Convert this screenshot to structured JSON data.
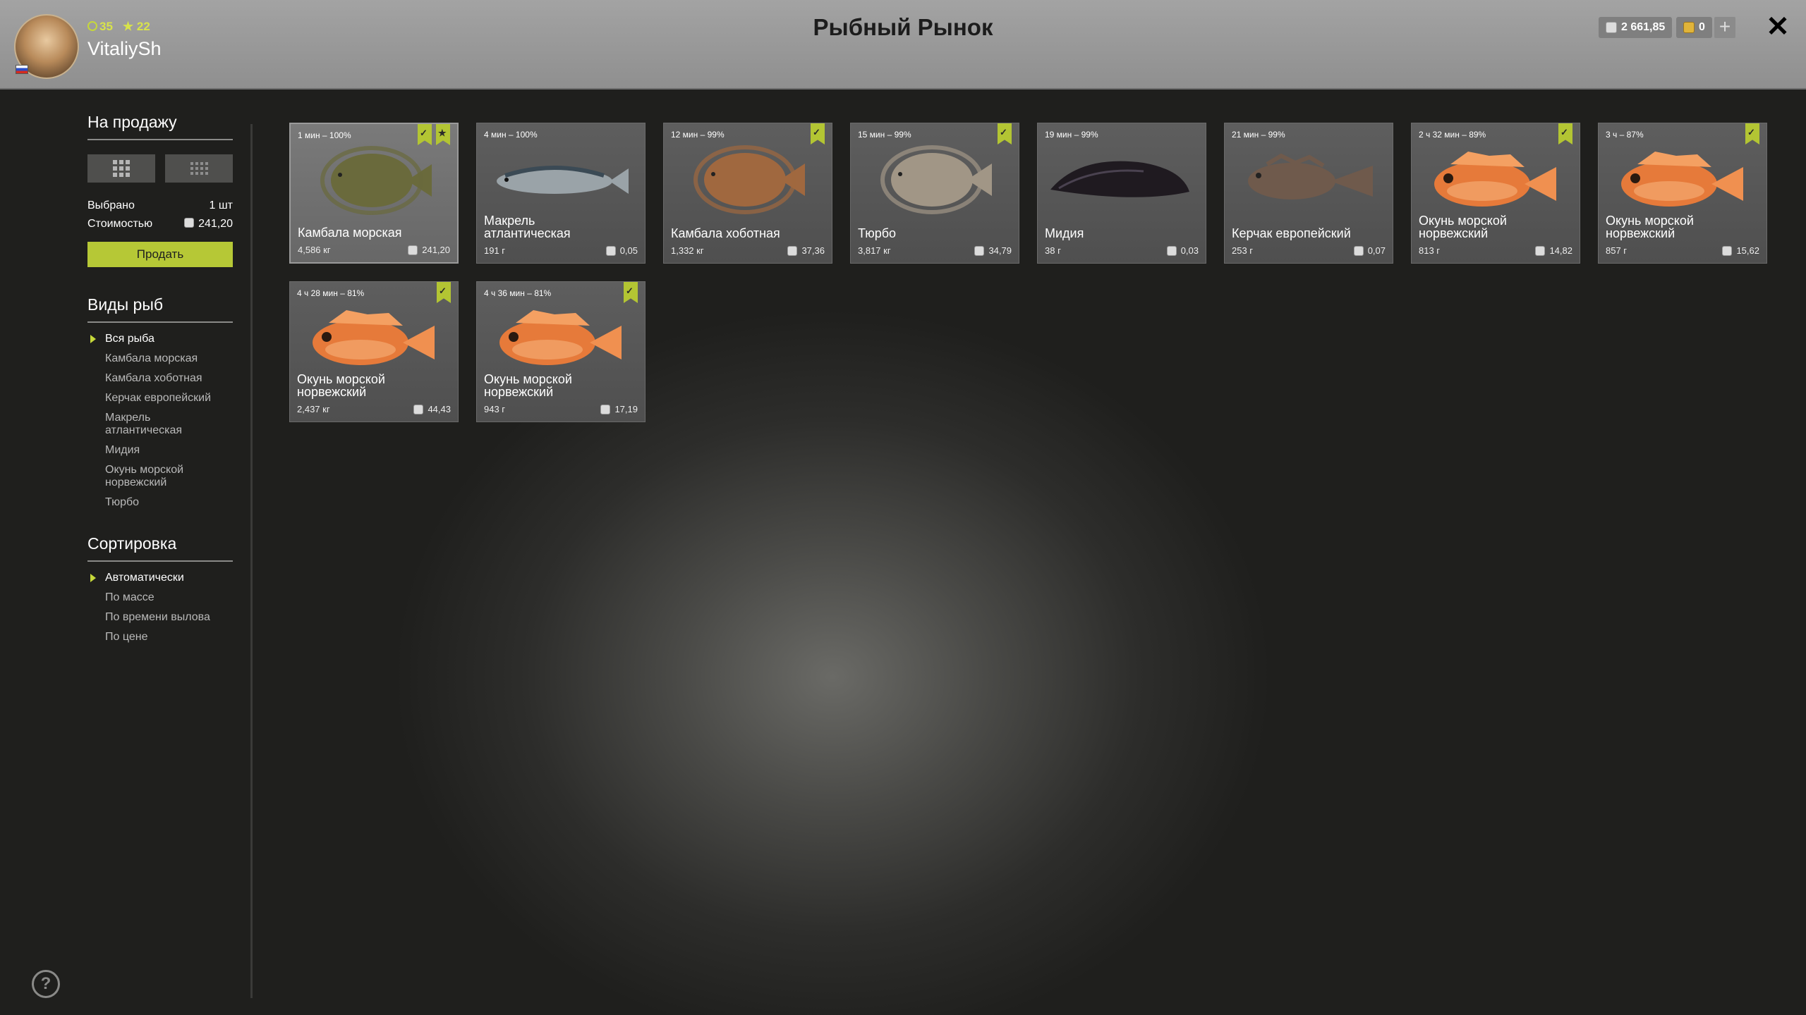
{
  "header": {
    "title": "Рыбный Рынок",
    "level": "35",
    "rating": "22",
    "username": "VitaliySh",
    "silver": "2 661,85",
    "gold": "0"
  },
  "sidebar": {
    "for_sale_title": "На продажу",
    "selected_label": "Выбрано",
    "selected_value": "1 шт",
    "cost_label": "Стоимостью",
    "cost_value": "241,20",
    "sell_label": "Продать",
    "species_title": "Виды рыб",
    "species": [
      "Вся рыба",
      "Камбала морская",
      "Камбала хоботная",
      "Керчак европейский",
      "Макрель атлантическая",
      "Мидия",
      "Окунь морской норвежский",
      "Тюрбо"
    ],
    "sort_title": "Сортировка",
    "sort": [
      "Автоматически",
      "По массе",
      "По времени вылова",
      "По цене"
    ]
  },
  "cards": [
    {
      "time": "1 мин – 100%",
      "name": "Камбала морская",
      "weight": "4,586 кг",
      "price": "241,20",
      "fish": "flounder-green",
      "color": "#6a6a3c",
      "checked": true,
      "starred": true,
      "selected": true
    },
    {
      "time": "4 мин – 100%",
      "name": "Макрель атлантическая",
      "weight": "191 г",
      "price": "0,05",
      "fish": "mackerel",
      "color": "#9aa3a8",
      "checked": false,
      "starred": false,
      "selected": false
    },
    {
      "time": "12 мин – 99%",
      "name": "Камбала хоботная",
      "weight": "1,332 кг",
      "price": "37,36",
      "fish": "flounder-brown",
      "color": "#a0683f",
      "checked": true,
      "starred": false,
      "selected": false
    },
    {
      "time": "15 мин – 99%",
      "name": "Тюрбо",
      "weight": "3,817 кг",
      "price": "34,79",
      "fish": "turbot",
      "color": "#a19686",
      "checked": true,
      "starred": false,
      "selected": false
    },
    {
      "time": "19 мин – 99%",
      "name": "Мидия",
      "weight": "38 г",
      "price": "0,03",
      "fish": "mussel",
      "color": "#1f1a20",
      "checked": false,
      "starred": false,
      "selected": false
    },
    {
      "time": "21 мин – 99%",
      "name": "Керчак европейский",
      "weight": "253 г",
      "price": "0,07",
      "fish": "sculpin",
      "color": "#6f5a4c",
      "checked": false,
      "starred": false,
      "selected": false
    },
    {
      "time": "2 ч 32 мин – 89%",
      "name": "Окунь морской норвежский",
      "weight": "813 г",
      "price": "14,82",
      "fish": "redfish",
      "color": "#e67a3a",
      "checked": true,
      "starred": false,
      "selected": false
    },
    {
      "time": "3 ч – 87%",
      "name": "Окунь морской норвежский",
      "weight": "857 г",
      "price": "15,62",
      "fish": "redfish",
      "color": "#e67a3a",
      "checked": true,
      "starred": false,
      "selected": false
    },
    {
      "time": "4 ч 28 мин – 81%",
      "name": "Окунь морской норвежский",
      "weight": "2,437 кг",
      "price": "44,43",
      "fish": "redfish",
      "color": "#e67a3a",
      "checked": true,
      "starred": false,
      "selected": false
    },
    {
      "time": "4 ч 36 мин – 81%",
      "name": "Окунь морской норвежский",
      "weight": "943 г",
      "price": "17,19",
      "fish": "redfish",
      "color": "#e67a3a",
      "checked": true,
      "starred": false,
      "selected": false
    }
  ],
  "help_icon": "?"
}
